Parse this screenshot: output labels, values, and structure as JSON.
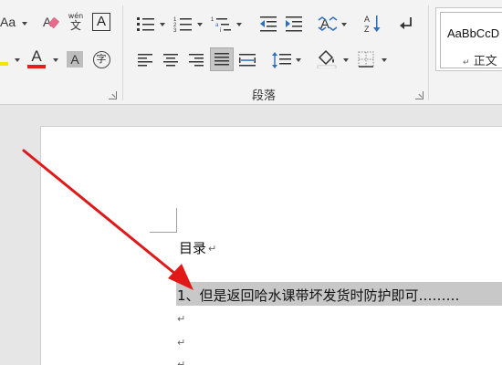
{
  "ribbon": {
    "font_group": {
      "font_size_label": "Aa",
      "phonetic_guide_top": "wén",
      "phonetic_guide_bottom": "文",
      "char_border_letter": "A",
      "font_color_letter": "A",
      "char_shading_letter": "A",
      "enclose_char_letter": "字",
      "font_color_accent": "#e02020",
      "highlight_accent": "#f5e400"
    },
    "paragraph_group": {
      "label": "段落"
    },
    "styles_group": {
      "sample_text": "AaBbCcD",
      "style_name": "正文",
      "style_marker": "↵"
    }
  },
  "document": {
    "heading_text": "目录",
    "toc_entry_text": "1、但是返回哈水课带坏发货时防护即可………",
    "para_mark": "↵",
    "colors": {
      "arrow": "#e01818",
      "selection": "#c8c8c8"
    }
  }
}
